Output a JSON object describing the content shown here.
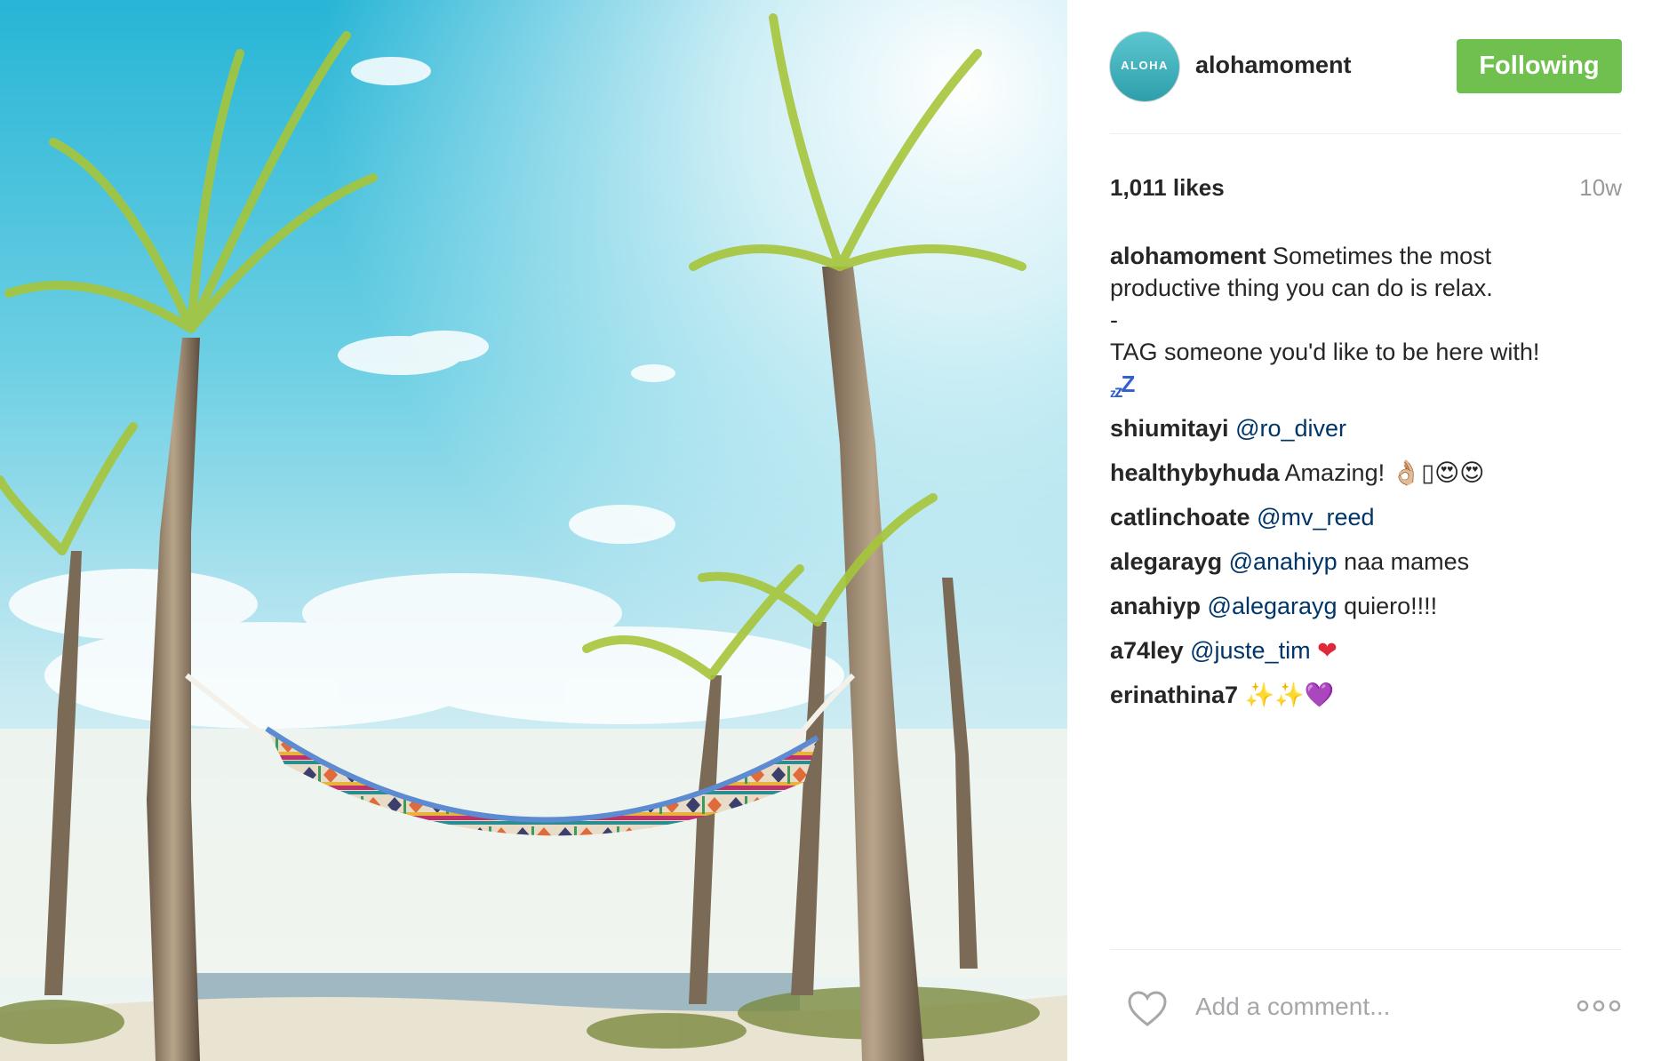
{
  "post": {
    "image_alt": "Colorful hammock tied between palm trees on a beach under a bright blue sky",
    "icon": "photo-icon"
  },
  "header": {
    "avatar_text": "ALOHA",
    "username": "alohamoment",
    "follow_label": "Following",
    "follow_color": "#70c050"
  },
  "stats": {
    "likes": "1,011 likes",
    "age": "10w"
  },
  "caption": {
    "username": "alohamoment",
    "line1": "Sometimes the most productive thing you can do is relax.",
    "dash": "-",
    "line2": "TAG someone you'd like to be here with!",
    "emoji": "zzZ"
  },
  "comments": [
    {
      "user": "shiumitayi",
      "mention": "@ro_diver",
      "text": "",
      "emoji": ""
    },
    {
      "user": "healthybyhuda",
      "mention": "",
      "text": "Amazing!",
      "emoji": "👌🏼▯😍😍"
    },
    {
      "user": "catlinchoate",
      "mention": "@mv_reed",
      "text": "",
      "emoji": ""
    },
    {
      "user": "alegarayg",
      "mention": "@anahiyp",
      "text": "naa mames",
      "emoji": ""
    },
    {
      "user": "anahiyp",
      "mention": "@alegarayg",
      "text": "quiero!!!!",
      "emoji": ""
    },
    {
      "user": "a74ley",
      "mention": "@juste_tim",
      "text": "",
      "emoji": "❤"
    },
    {
      "user": "erinathina7",
      "mention": "",
      "text": "",
      "emoji": "✨✨💜"
    }
  ],
  "footer": {
    "like_icon": "heart-outline-icon",
    "comment_placeholder": "Add a comment...",
    "more_icon": "more-options-icon"
  }
}
